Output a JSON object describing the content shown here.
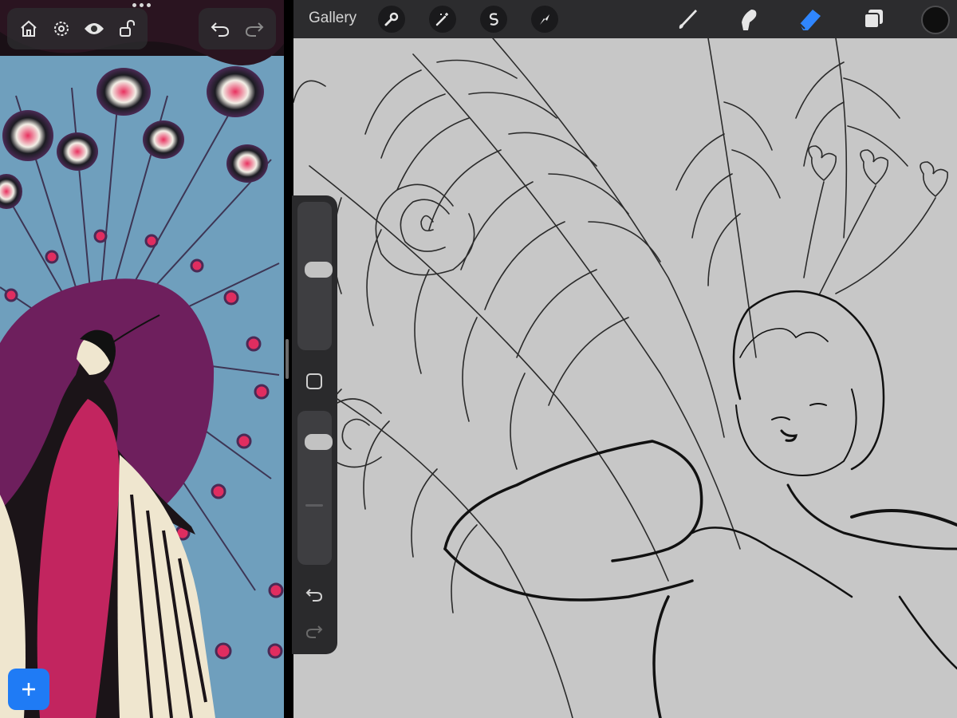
{
  "reference": {
    "toolbar_icons": [
      "home-icon",
      "gear-icon",
      "eye-icon",
      "unlock-icon"
    ],
    "undo_icons": [
      "undo-icon",
      "redo-icon"
    ],
    "add_button_icon": "plus-icon",
    "image_description_colors": {
      "background": "#6f9fbd",
      "purple": "#6e1f5d",
      "magenta": "#c2255f",
      "cream": "#efe6cf"
    }
  },
  "topbar": {
    "gallery_label": "Gallery",
    "action_icons": [
      "wrench-icon",
      "magic-wand-icon",
      "selection-icon",
      "transform-arrow-icon"
    ],
    "tool_icons": [
      "brush-icon",
      "smudge-icon",
      "eraser-icon",
      "layers-icon"
    ],
    "active_tool": "eraser-icon",
    "accent_color": "#2f86ff",
    "current_color": "#0f0f0f"
  },
  "sidebar": {
    "brush_size_level": 0.55,
    "opacity_level": 0.85,
    "modify_icon": "square-icon",
    "undo_icon": "undo-icon",
    "redo_icon": "redo-icon"
  }
}
